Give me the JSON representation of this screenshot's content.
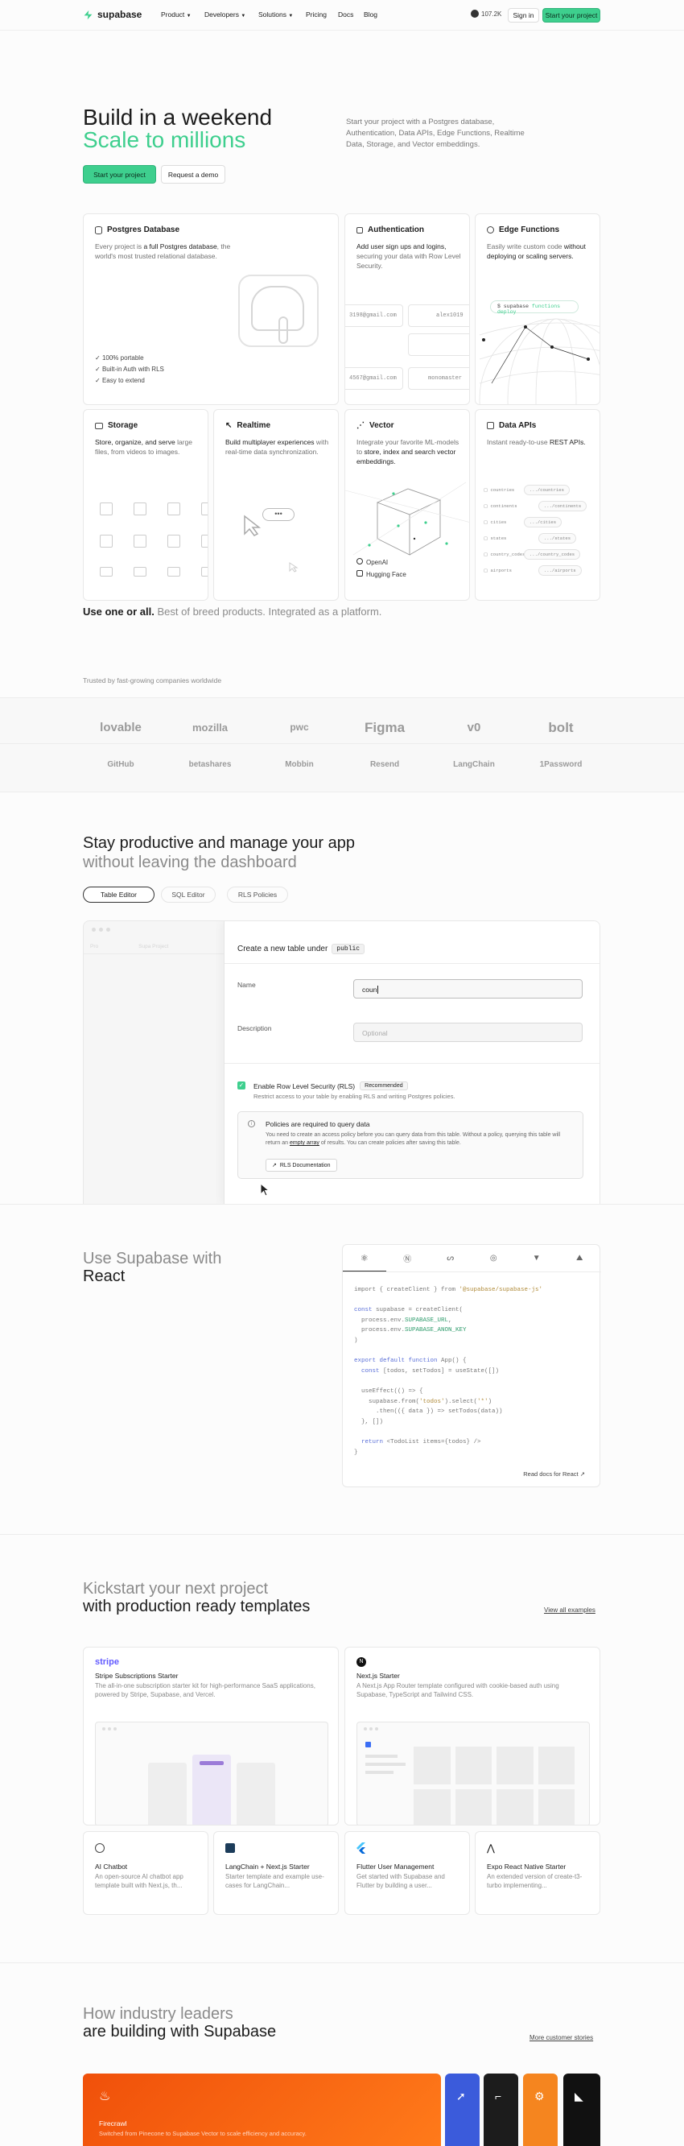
{
  "nav": {
    "brand": "supabase",
    "items": [
      "Product",
      "Developers",
      "Solutions",
      "Pricing",
      "Docs",
      "Blog"
    ],
    "stars": "107.2K",
    "sign_in": "Sign in",
    "start": "Start your project"
  },
  "hero": {
    "title1": "Build in a weekend",
    "title2": "Scale to millions",
    "desc": "Start your project with a Postgres database, Authentication, Data APIs, Edge Functions, Realtime Data, Storage, and Vector embeddings.",
    "primary": "Start your project",
    "secondary": "Request a demo"
  },
  "features": {
    "postgres": {
      "title": "Postgres Database",
      "desc_pre": "Every project is ",
      "desc_b": "a full Postgres database",
      "desc_post": ", the world's most trusted relational database.",
      "checks": [
        "100% portable",
        "Built-in Auth with RLS",
        "Easy to extend"
      ]
    },
    "auth": {
      "title": "Authentication",
      "desc_b": "Add user sign ups and logins,",
      "desc_post": " securing your data with Row Level Security.",
      "emails": [
        "3198@gmail.com",
        "alex1019",
        "4567@gmail.com",
        "monomaster"
      ]
    },
    "edge": {
      "title": "Edge Functions",
      "desc_pre": "Easily write custom code ",
      "desc_b": "without deploying or scaling servers.",
      "cmd_a": "$ supabase",
      "cmd_b": "functions deploy"
    },
    "storage": {
      "title": "Storage",
      "desc_b": "Store, organize, and serve",
      "desc_post": " large files, from videos to images."
    },
    "realtime": {
      "title": "Realtime",
      "desc_b": "Build multiplayer experiences",
      "desc_post": " with real-time data synchronization.",
      "bubble": "•••"
    },
    "vector": {
      "title": "Vector",
      "desc_pre": "Integrate your favorite ML-models to ",
      "desc_b": "store, index and search vector embeddings.",
      "providers": [
        "OpenAI",
        "Hugging Face"
      ]
    },
    "apis": {
      "title": "Data APIs",
      "desc_pre": "Instant ready-to-use ",
      "desc_b": "REST APIs.",
      "rows": [
        [
          "countries",
          ".../countries"
        ],
        [
          "continents",
          ".../continents"
        ],
        [
          "cities",
          ".../cities"
        ],
        [
          "states",
          ".../states"
        ],
        [
          "country_codes",
          ".../country_codes"
        ],
        [
          "airports",
          ".../airports"
        ]
      ]
    },
    "tagline_b": "Use one or all.",
    "tagline": " Best of breed products. Integrated as a platform."
  },
  "trusted": {
    "label": "Trusted by fast-growing companies worldwide",
    "row1": [
      "lovable",
      "mozilla",
      "pwc",
      "Figma",
      "v0",
      "bolt"
    ],
    "row2": [
      "GitHub",
      "betashares",
      "Mobbin",
      "Resend",
      "LangChain",
      "1Password"
    ]
  },
  "dashboard": {
    "title1": "Stay productive and manage your app",
    "title2": "without leaving the dashboard",
    "tabs": [
      "Table Editor",
      "SQL Editor",
      "RLS Policies"
    ],
    "bg_hint_a": "Pro",
    "bg_hint_b": "Supa Project",
    "panel_title": "Create a new table under",
    "schema": "public",
    "name_label": "Name",
    "name_value": "coun",
    "desc_label": "Description",
    "desc_placeholder": "Optional",
    "rls_label": "Enable Row Level Security (RLS)",
    "rls_badge": "Recommended",
    "rls_desc": "Restrict access to your table by enabling RLS and writing Postgres policies.",
    "policy_title": "Policies are required to query data",
    "policy_desc_a": "You need to create an access policy before you can query data from this table. Without a policy, querying this table will return an ",
    "policy_desc_u": "empty array",
    "policy_desc_b": " of results. You can create policies after saving this table.",
    "docs_btn": "RLS Documentation"
  },
  "frameworks": {
    "title1": "Use Supabase with",
    "title2": "React",
    "code": [
      [
        [
          "import { createClient } from ",
          "#777"
        ],
        [
          "'@supabase/supabase-js'",
          "#b08b3a"
        ]
      ],
      [],
      [
        [
          "const ",
          "#5a6fd8"
        ],
        [
          "supabase = createClient(",
          "#777"
        ]
      ],
      [
        [
          "  process.env.",
          "#777"
        ],
        [
          "SUPABASE_URL",
          "#2f9c6c"
        ],
        [
          ",",
          "#777"
        ]
      ],
      [
        [
          "  process.env.",
          "#777"
        ],
        [
          "SUPABASE_ANON_KEY",
          "#2f9c6c"
        ]
      ],
      [
        [
          ")",
          "#777"
        ]
      ],
      [],
      [
        [
          "export default function ",
          "#5a6fd8"
        ],
        [
          "App() {",
          "#777"
        ]
      ],
      [
        [
          "  const ",
          "#5a6fd8"
        ],
        [
          "[todos, setTodos] = useState([])",
          "#777"
        ]
      ],
      [],
      [
        [
          "  useEffect(() => {",
          "#777"
        ]
      ],
      [
        [
          "    supabase.from(",
          "#777"
        ],
        [
          "'todos'",
          "#b08b3a"
        ],
        [
          ").select(",
          "#777"
        ],
        [
          "'*'",
          "#b08b3a"
        ],
        [
          ")",
          "#777"
        ]
      ],
      [
        [
          "      .then(({ data }) => setTodos(data))",
          "#777"
        ]
      ],
      [
        [
          "  }, [])",
          "#777"
        ]
      ],
      [],
      [
        [
          "  return ",
          "#5a6fd8"
        ],
        [
          "<TodoList items={todos} />",
          "#777"
        ]
      ],
      [
        [
          "}",
          "#777"
        ]
      ]
    ],
    "docs_link": "Read docs for React"
  },
  "templates": {
    "title1": "Kickstart your next project",
    "title2": "with production ready templates",
    "view_all": "View all examples",
    "big": [
      {
        "logo": "stripe",
        "name": "Stripe Subscriptions Starter",
        "desc": "The all-in-one subscription starter kit for high-performance SaaS applications, powered by Stripe, Supabase, and Vercel."
      },
      {
        "logo": "N",
        "name": "Next.js Starter",
        "desc": "A Next.js App Router template configured with cookie-based auth using Supabase, TypeScript and Tailwind CSS."
      }
    ],
    "small": [
      {
        "name": "AI Chatbot",
        "desc": "An open-source AI chatbot app template built with Next.js, th..."
      },
      {
        "name": "LangChain + Next.js Starter",
        "desc": "Starter template and example use-cases for LangChain..."
      },
      {
        "name": "Flutter User Management",
        "desc": "Get started with Supabase and Flutter by building a user..."
      },
      {
        "name": "Expo React Native Starter",
        "desc": "An extended version of create-t3-turbo implementing..."
      }
    ]
  },
  "leaders": {
    "title1": "How industry leaders",
    "title2": "are building with Supabase",
    "more": "More customer stories",
    "story_name": "Firecrawl",
    "story_desc": "Switched from Pinecone to Supabase Vector to scale efficiency and accuracy."
  },
  "colors": {
    "brand": "#3ecf8e",
    "orange": "#f5520b"
  }
}
